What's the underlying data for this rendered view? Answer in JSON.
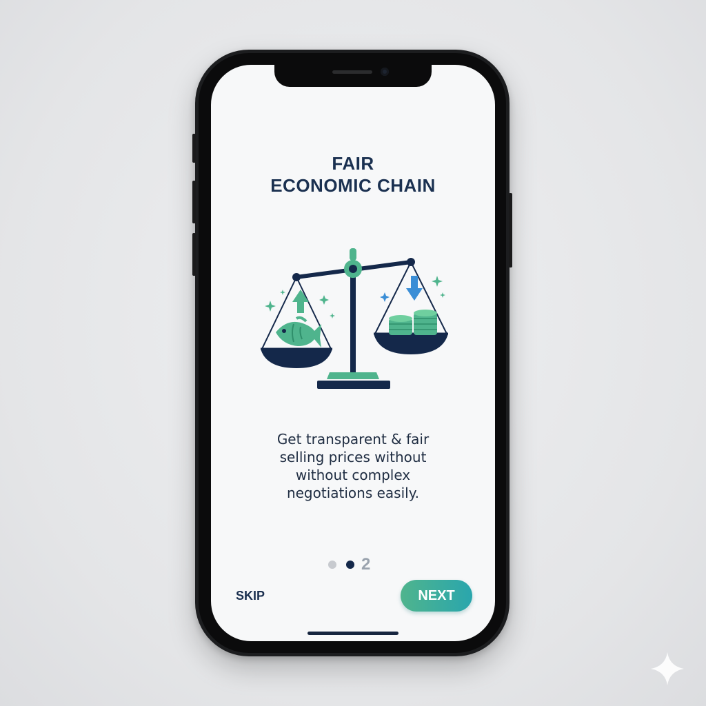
{
  "screen": {
    "title_line1": "FAIR",
    "title_line2": "ECONOMIC CHAIN",
    "illustration": {
      "icons": [
        "balance-scale-icon",
        "fish-icon",
        "coin-stack-icon",
        "arrow-up-icon",
        "arrow-down-icon",
        "sparkle-icon"
      ]
    },
    "description_lines": [
      "Get transparent & fair",
      "selling prices without",
      "without complex",
      "negotiations easily."
    ],
    "pagination": {
      "page_label": "2",
      "current_index": 2
    },
    "skip_label": "SKIP",
    "next_label": "NEXT"
  },
  "colors": {
    "navy": "#1a3050",
    "green": "#4fb48d",
    "teal": "#2aa6ad",
    "blue_arrow": "#3b8ed6"
  }
}
